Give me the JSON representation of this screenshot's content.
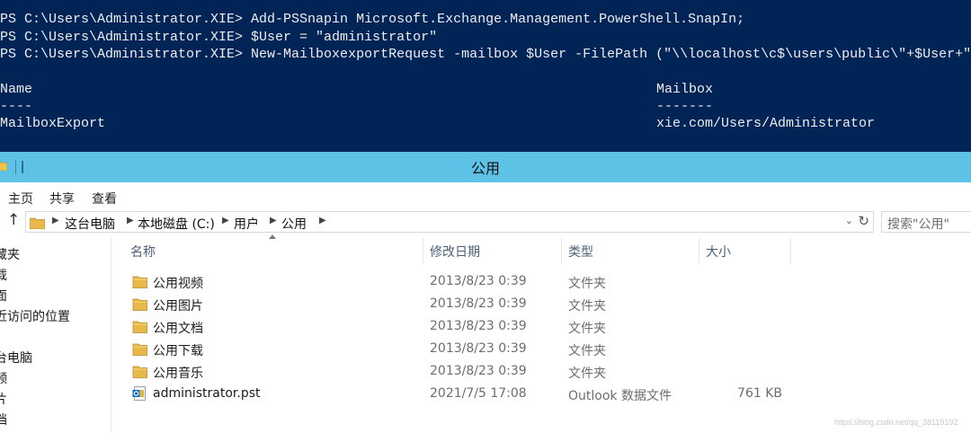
{
  "console": {
    "lines": [
      "PS C:\\Users\\Administrator.XIE> Add-PSSnapin Microsoft.Exchange.Management.PowerShell.SnapIn;",
      "PS C:\\Users\\Administrator.XIE> $User = \"administrator\"",
      "PS C:\\Users\\Administrator.XIE> New-MailboxexportRequest -mailbox $User -FilePath (\"\\\\localhost\\c$\\users\\public\\\"+$User+\".pst\")"
    ],
    "table": {
      "headers": [
        "Name",
        "Mailbox"
      ],
      "underlines": [
        "----",
        "-------"
      ],
      "row": [
        "MailboxExport",
        "xie.com/Users/Administrator"
      ]
    }
  },
  "window": {
    "title": "公用"
  },
  "ribbon": {
    "tabs": [
      "主页",
      "共享",
      "查看"
    ]
  },
  "address": {
    "crumbs": [
      "这台电脑",
      "本地磁盘 (C:)",
      "用户",
      "公用"
    ],
    "search_placeholder": "搜索\"公用\""
  },
  "nav": {
    "items": [
      "藏夹",
      "载",
      "面",
      "近访问的位置",
      "",
      "台电脑",
      "频",
      "片",
      "档"
    ]
  },
  "files": {
    "columns": [
      "名称",
      "修改日期",
      "类型",
      "大小"
    ],
    "rows": [
      {
        "name": "公用视频",
        "date": "2013/8/23 0:39",
        "type": "文件夹",
        "size": "",
        "icon": "folder-icon"
      },
      {
        "name": "公用图片",
        "date": "2013/8/23 0:39",
        "type": "文件夹",
        "size": "",
        "icon": "folder-icon"
      },
      {
        "name": "公用文档",
        "date": "2013/8/23 0:39",
        "type": "文件夹",
        "size": "",
        "icon": "folder-icon"
      },
      {
        "name": "公用下载",
        "date": "2013/8/23 0:39",
        "type": "文件夹",
        "size": "",
        "icon": "folder-icon"
      },
      {
        "name": "公用音乐",
        "date": "2013/8/23 0:39",
        "type": "文件夹",
        "size": "",
        "icon": "folder-icon"
      },
      {
        "name": "administrator.pst",
        "date": "2021/7/5 17:08",
        "type": "Outlook 数据文件",
        "size": "761 KB",
        "icon": "pst-file-icon"
      }
    ]
  },
  "watermark": "https://blog.csdn.net/qq_38119192",
  "colors": {
    "console_bg": "#012456",
    "titlebar_bg": "#5ec1e6",
    "folder": "#e8b84a"
  }
}
